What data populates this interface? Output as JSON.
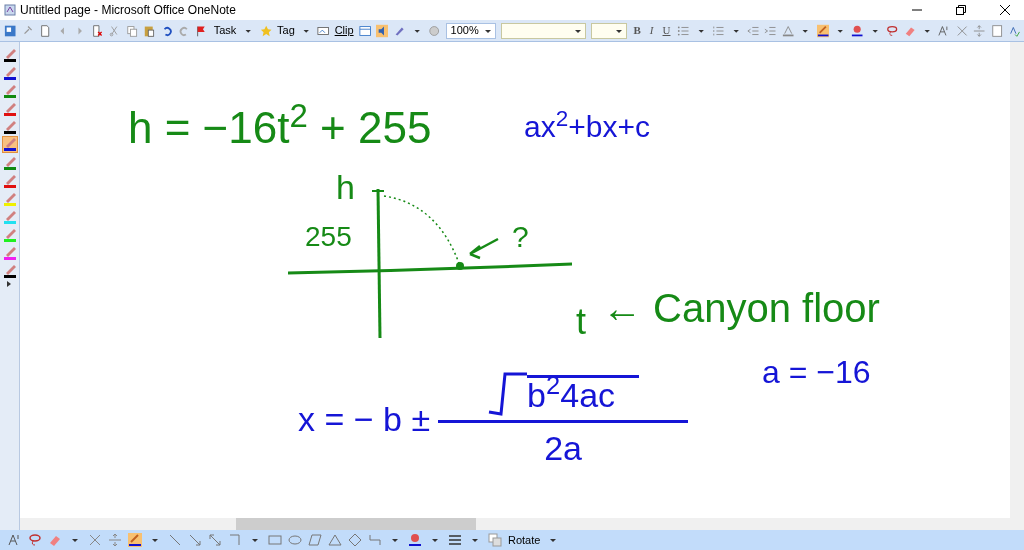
{
  "window": {
    "title": "Untitled page - Microsoft Office OneNote"
  },
  "toolbar": {
    "task": "Task",
    "tag": "Tag",
    "clip": "Clip",
    "zoom": "100%",
    "bold": "B",
    "italic": "I",
    "underline": "U"
  },
  "pens": [
    {
      "color": "#000000",
      "selected": false
    },
    {
      "color": "#1010d0",
      "selected": false
    },
    {
      "color": "#108a10",
      "selected": false
    },
    {
      "color": "#e01010",
      "selected": false
    },
    {
      "color": "#000000",
      "selected": false
    },
    {
      "color": "#1010d0",
      "selected": true
    },
    {
      "color": "#108a10",
      "selected": false
    },
    {
      "color": "#e01010",
      "selected": false
    },
    {
      "color": "#f0f000",
      "selected": false
    },
    {
      "color": "#20e0f0",
      "selected": false
    },
    {
      "color": "#20f020",
      "selected": false
    },
    {
      "color": "#f020f0",
      "selected": false
    },
    {
      "color": "#000000",
      "selected": false
    }
  ],
  "ink": [
    {
      "kind": "text",
      "text": "h = −16t$^{2}$ + 255",
      "color": "#168a16"
    },
    {
      "kind": "text",
      "text": "ax$^{2}$+bx+c",
      "color": "#1515d6"
    },
    {
      "kind": "label",
      "text": "h",
      "color": "#168a16"
    },
    {
      "kind": "label",
      "text": "255",
      "color": "#168a16"
    },
    {
      "kind": "label",
      "text": "?",
      "color": "#168a16"
    },
    {
      "kind": "label",
      "text": "t",
      "color": "#168a16"
    },
    {
      "kind": "text",
      "text": "← Canyon floor",
      "color": "#168a16"
    },
    {
      "kind": "text",
      "text": "a = −16",
      "color": "#1515d6"
    },
    {
      "kind": "formula",
      "lead": "x = − b ±",
      "radicand": "b$^{2}$4ac",
      "denominator": "2a",
      "color": "#1515d6"
    }
  ],
  "bottom_toolbar": {
    "rotate": "Rotate"
  }
}
